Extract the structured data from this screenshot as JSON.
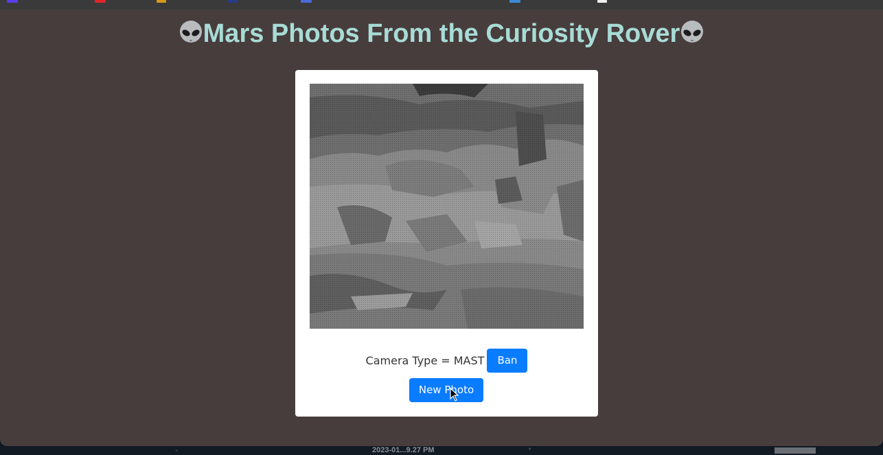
{
  "page": {
    "title": "Mars Photos From the Curiosity Rover",
    "title_icon": "alien-emoji",
    "background_color": "#483d3d",
    "title_color": "#a8dcd6"
  },
  "card": {
    "photo_alt": "Mars surface photo",
    "camera_label": "Camera Type = MAST",
    "ban_button": "Ban",
    "new_photo_button": "New Photo",
    "button_color": "#0a7cff"
  },
  "desktop": {
    "timestamp_label": "2023-01...9.27 PM"
  }
}
